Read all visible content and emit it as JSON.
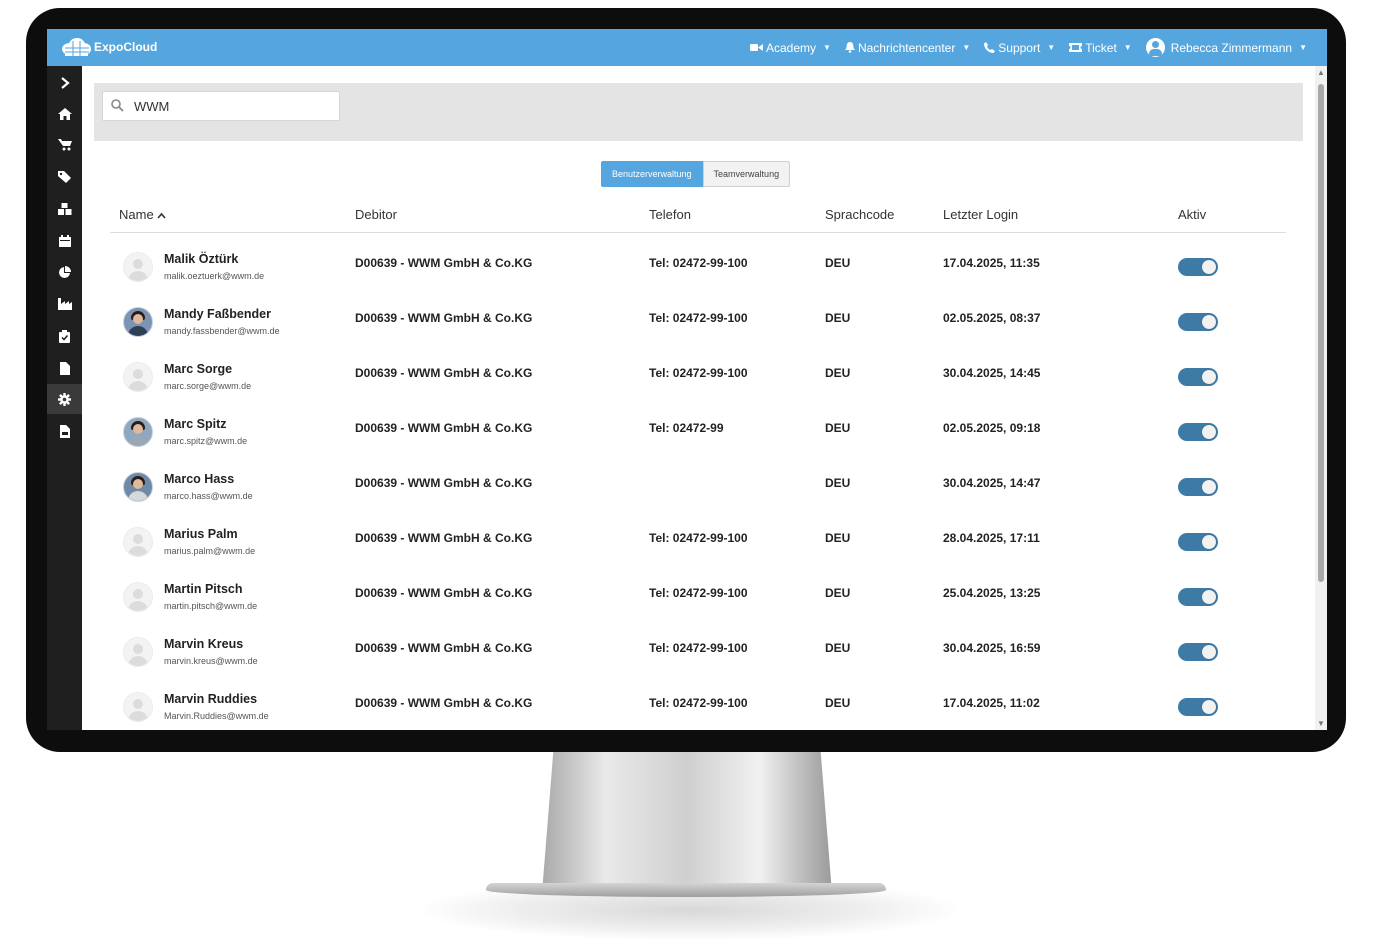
{
  "app": {
    "name": "ExpoCloud"
  },
  "nav": [
    {
      "label": "Academy",
      "icon": "video-camera-icon"
    },
    {
      "label": "Nachrichtencenter",
      "icon": "bell-icon"
    },
    {
      "label": "Support",
      "icon": "phone-icon"
    },
    {
      "label": "Ticket",
      "icon": "ticket-icon"
    }
  ],
  "user": {
    "name": "Rebecca Zimmermann"
  },
  "sidebar": {
    "items": [
      {
        "icon": "chevron-right-icon"
      },
      {
        "icon": "home-icon"
      },
      {
        "icon": "shopping-cart-icon"
      },
      {
        "icon": "tags-icon"
      },
      {
        "icon": "boxes-icon"
      },
      {
        "icon": "calendar-icon"
      },
      {
        "icon": "pie-chart-icon"
      },
      {
        "icon": "industry-icon"
      },
      {
        "icon": "clipboard-check-icon"
      },
      {
        "icon": "file-icon"
      },
      {
        "icon": "gear-icon",
        "active": true
      },
      {
        "icon": "file-pdf-icon"
      }
    ]
  },
  "search": {
    "value": "WWM"
  },
  "tabs": [
    {
      "label": "Benutzerverwaltung",
      "active": true
    },
    {
      "label": "Teamverwaltung",
      "active": false
    }
  ],
  "table": {
    "columns": [
      "Name",
      "Debitor",
      "Telefon",
      "Sprachcode",
      "Letzter Login",
      "Aktiv"
    ],
    "sort": {
      "column": "Name",
      "direction": "ascending"
    },
    "rows": [
      {
        "name": "Malik Öztürk",
        "email": "malik.oeztuerk@wwm.de",
        "debitor": "D00639 - WWM GmbH & Co.KG",
        "telefon": "Tel: 02472-99-100",
        "sprachcode": "DEU",
        "login": "17.04.2025, 11:35",
        "aktiv": true,
        "avatar": "placeholder"
      },
      {
        "name": "Mandy Faßbender",
        "email": "mandy.fassbender@wwm.de",
        "debitor": "D00639 - WWM GmbH & Co.KG",
        "telefon": "Tel: 02472-99-100",
        "sprachcode": "DEU",
        "login": "02.05.2025, 08:37",
        "aktiv": true,
        "avatar": "photo"
      },
      {
        "name": "Marc Sorge",
        "email": "marc.sorge@wwm.de",
        "debitor": "D00639 - WWM GmbH & Co.KG",
        "telefon": "Tel: 02472-99-100",
        "sprachcode": "DEU",
        "login": "30.04.2025, 14:45",
        "aktiv": true,
        "avatar": "placeholder"
      },
      {
        "name": "Marc Spitz",
        "email": "marc.spitz@wwm.de",
        "debitor": "D00639 - WWM GmbH & Co.KG",
        "telefon": "Tel: 02472-99",
        "sprachcode": "DEU",
        "login": "02.05.2025, 09:18",
        "aktiv": true,
        "avatar": "photo"
      },
      {
        "name": "Marco Hass",
        "email": "marco.hass@wwm.de",
        "debitor": "D00639 - WWM GmbH & Co.KG",
        "telefon": "",
        "sprachcode": "DEU",
        "login": "30.04.2025, 14:47",
        "aktiv": true,
        "avatar": "photo"
      },
      {
        "name": "Marius Palm",
        "email": "marius.palm@wwm.de",
        "debitor": "D00639 - WWM GmbH & Co.KG",
        "telefon": "Tel: 02472-99-100",
        "sprachcode": "DEU",
        "login": "28.04.2025, 17:11",
        "aktiv": true,
        "avatar": "placeholder"
      },
      {
        "name": "Martin Pitsch",
        "email": "martin.pitsch@wwm.de",
        "debitor": "D00639 - WWM GmbH & Co.KG",
        "telefon": "Tel: 02472-99-100",
        "sprachcode": "DEU",
        "login": "25.04.2025, 13:25",
        "aktiv": true,
        "avatar": "placeholder"
      },
      {
        "name": "Marvin Kreus",
        "email": "marvin.kreus@wwm.de",
        "debitor": "D00639 - WWM GmbH & Co.KG",
        "telefon": "Tel: 02472-99-100",
        "sprachcode": "DEU",
        "login": "30.04.2025, 16:59",
        "aktiv": true,
        "avatar": "placeholder"
      },
      {
        "name": "Marvin Ruddies",
        "email": "Marvin.Ruddies@wwm.de",
        "debitor": "D00639 - WWM GmbH & Co.KG",
        "telefon": "Tel: 02472-99-100",
        "sprachcode": "DEU",
        "login": "17.04.2025, 11:02",
        "aktiv": true,
        "avatar": "placeholder"
      }
    ]
  },
  "colors": {
    "brand": "#55a6de",
    "sidebar": "#1f1f1f",
    "toggle_on": "#3e7aa6"
  }
}
